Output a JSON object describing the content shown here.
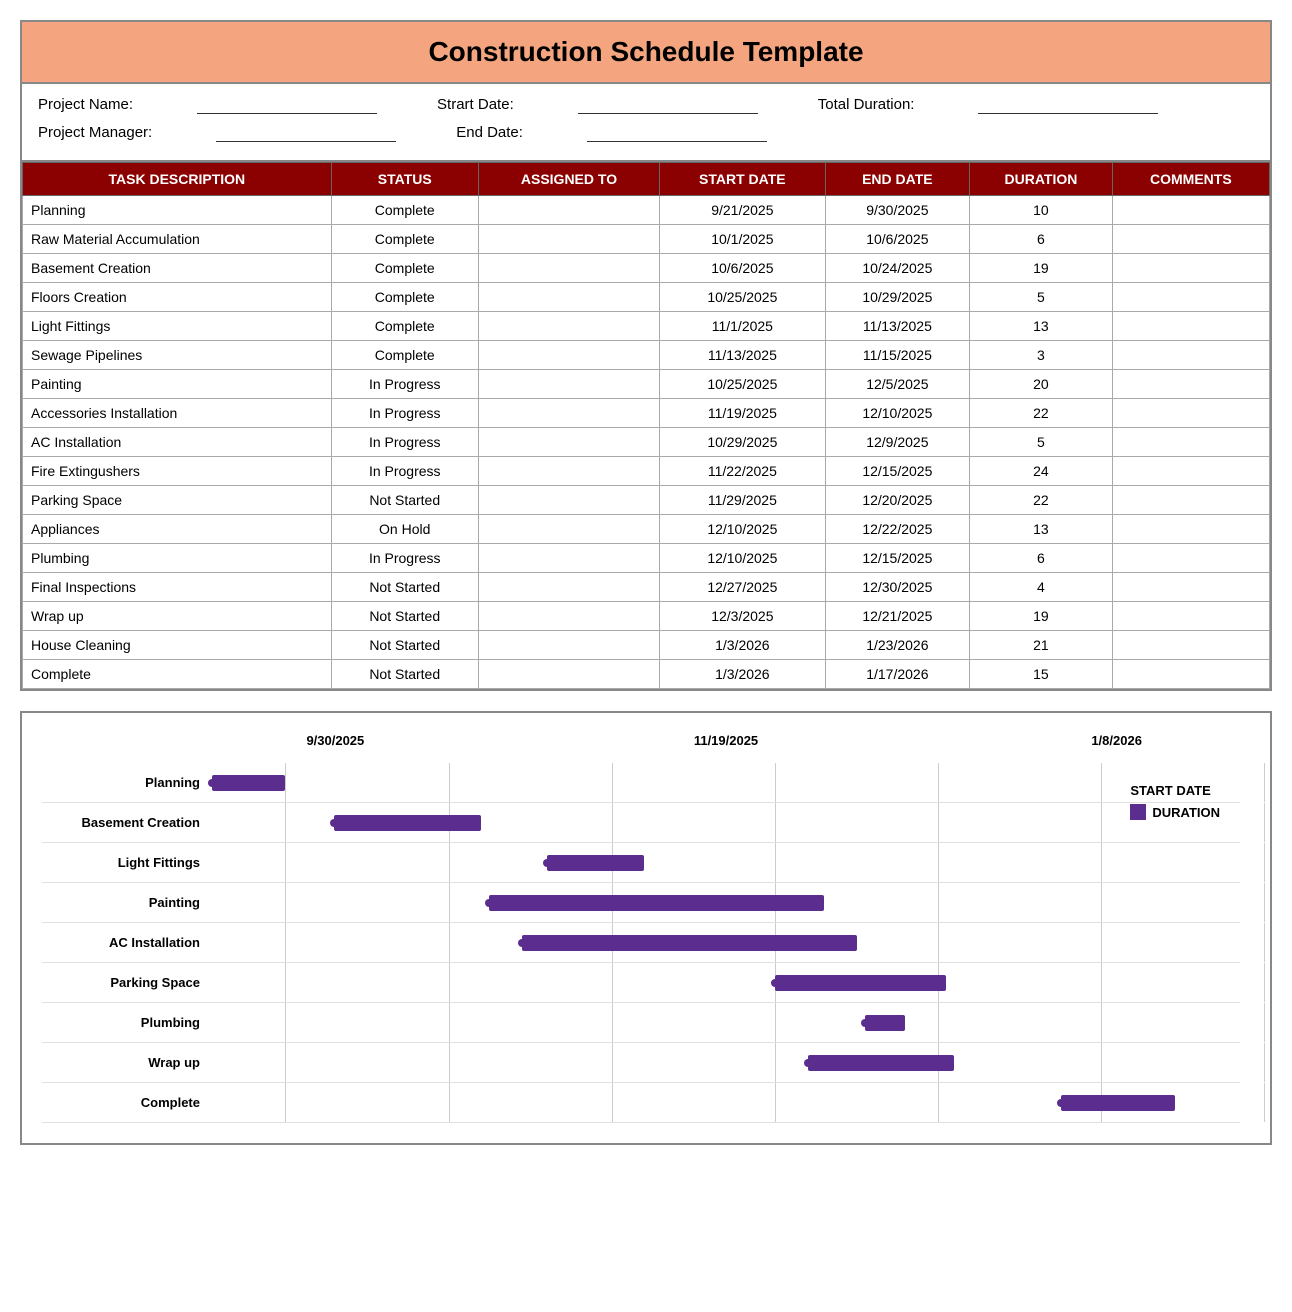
{
  "title": "Construction Schedule Template",
  "projectInfo": {
    "projectNameLabel": "Project Name:",
    "startDateLabel": "Strart Date:",
    "totalDurationLabel": "Total Duration:",
    "projectManagerLabel": "Project Manager:",
    "endDateLabel": "End Date:"
  },
  "tableHeaders": {
    "taskDescription": "TASK DESCRIPTION",
    "status": "STATUS",
    "assignedTo": "ASSIGNED TO",
    "startDate": "START DATE",
    "endDate": "END DATE",
    "duration": "DURATION",
    "comments": "COMMENTS"
  },
  "tasks": [
    {
      "name": "Planning",
      "status": "Complete",
      "assigned": "",
      "startDate": "9/21/2025",
      "endDate": "9/30/2025",
      "duration": "10",
      "comments": ""
    },
    {
      "name": "Raw Material Accumulation",
      "status": "Complete",
      "assigned": "",
      "startDate": "10/1/2025",
      "endDate": "10/6/2025",
      "duration": "6",
      "comments": ""
    },
    {
      "name": "Basement Creation",
      "status": "Complete",
      "assigned": "",
      "startDate": "10/6/2025",
      "endDate": "10/24/2025",
      "duration": "19",
      "comments": ""
    },
    {
      "name": "Floors Creation",
      "status": "Complete",
      "assigned": "",
      "startDate": "10/25/2025",
      "endDate": "10/29/2025",
      "duration": "5",
      "comments": ""
    },
    {
      "name": "Light Fittings",
      "status": "Complete",
      "assigned": "",
      "startDate": "11/1/2025",
      "endDate": "11/13/2025",
      "duration": "13",
      "comments": ""
    },
    {
      "name": "Sewage Pipelines",
      "status": "Complete",
      "assigned": "",
      "startDate": "11/13/2025",
      "endDate": "11/15/2025",
      "duration": "3",
      "comments": ""
    },
    {
      "name": "Painting",
      "status": "In Progress",
      "assigned": "",
      "startDate": "10/25/2025",
      "endDate": "12/5/2025",
      "duration": "20",
      "comments": ""
    },
    {
      "name": "Accessories Installation",
      "status": "In Progress",
      "assigned": "",
      "startDate": "11/19/2025",
      "endDate": "12/10/2025",
      "duration": "22",
      "comments": ""
    },
    {
      "name": "AC Installation",
      "status": "In Progress",
      "assigned": "",
      "startDate": "10/29/2025",
      "endDate": "12/9/2025",
      "duration": "5",
      "comments": ""
    },
    {
      "name": "Fire Extingushers",
      "status": "In Progress",
      "assigned": "",
      "startDate": "11/22/2025",
      "endDate": "12/15/2025",
      "duration": "24",
      "comments": ""
    },
    {
      "name": "Parking Space",
      "status": "Not Started",
      "assigned": "",
      "startDate": "11/29/2025",
      "endDate": "12/20/2025",
      "duration": "22",
      "comments": ""
    },
    {
      "name": "Appliances",
      "status": "On Hold",
      "assigned": "",
      "startDate": "12/10/2025",
      "endDate": "12/22/2025",
      "duration": "13",
      "comments": ""
    },
    {
      "name": "Plumbing",
      "status": "In Progress",
      "assigned": "",
      "startDate": "12/10/2025",
      "endDate": "12/15/2025",
      "duration": "6",
      "comments": ""
    },
    {
      "name": "Final Inspections",
      "status": "Not Started",
      "assigned": "",
      "startDate": "12/27/2025",
      "endDate": "12/30/2025",
      "duration": "4",
      "comments": ""
    },
    {
      "name": "Wrap up",
      "status": "Not Started",
      "assigned": "",
      "startDate": "12/3/2025",
      "endDate": "12/21/2025",
      "duration": "19",
      "comments": ""
    },
    {
      "name": "House Cleaning",
      "status": "Not Started",
      "assigned": "",
      "startDate": "1/3/2026",
      "endDate": "1/23/2026",
      "duration": "21",
      "comments": ""
    },
    {
      "name": "Complete",
      "status": "Not Started",
      "assigned": "",
      "startDate": "1/3/2026",
      "endDate": "1/17/2026",
      "duration": "15",
      "comments": ""
    }
  ],
  "gantt": {
    "dateLabels": [
      "9/30/2025",
      "11/19/2025",
      "1/8/2026"
    ],
    "taskLabels": [
      "Planning",
      "Basement Creation",
      "Light Fittings",
      "Painting",
      "AC Installation",
      "Parking Space",
      "Plumbing",
      "Wrap up",
      "Complete"
    ],
    "legendStartDate": "START DATE",
    "legendDuration": "DURATION"
  }
}
